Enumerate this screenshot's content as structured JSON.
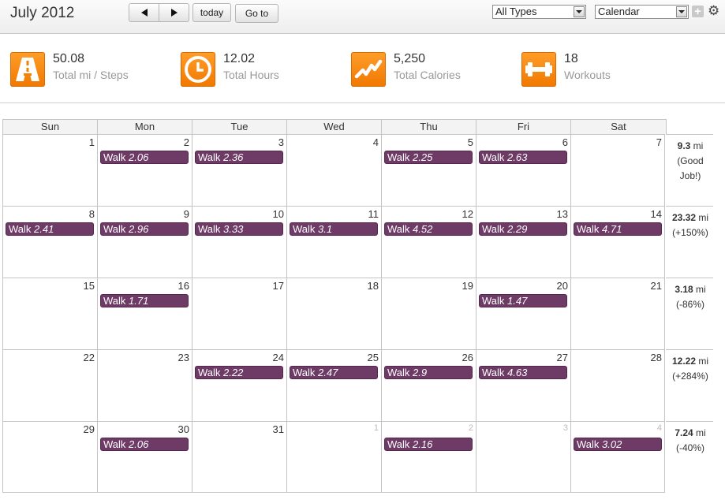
{
  "header": {
    "month_title": "July 2012",
    "today_label": "today",
    "goto_label": "Go to",
    "types_select": "All Types",
    "view_select": "Calendar"
  },
  "stats": [
    {
      "value": "50.08",
      "label": "Total mi / Steps",
      "icon": "road-icon"
    },
    {
      "value": "12.02",
      "label": "Total Hours",
      "icon": "clock-icon"
    },
    {
      "value": "5,250",
      "label": "Total Calories",
      "icon": "activity-chart-icon"
    },
    {
      "value": "18",
      "label": "Workouts",
      "icon": "dumbbell-icon"
    }
  ],
  "weekdays": [
    "Sun",
    "Mon",
    "Tue",
    "Wed",
    "Thu",
    "Fri",
    "Sat"
  ],
  "weeks": [
    {
      "days": [
        {
          "num": "1",
          "event": null,
          "other": false
        },
        {
          "num": "2",
          "event": {
            "type": "Walk",
            "value": "2.06"
          },
          "other": false
        },
        {
          "num": "3",
          "event": {
            "type": "Walk",
            "value": "2.36"
          },
          "other": false
        },
        {
          "num": "4",
          "event": null,
          "other": false
        },
        {
          "num": "5",
          "event": {
            "type": "Walk",
            "value": "2.25"
          },
          "other": false
        },
        {
          "num": "6",
          "event": {
            "type": "Walk",
            "value": "2.63"
          },
          "other": false
        },
        {
          "num": "7",
          "event": null,
          "other": false
        }
      ],
      "summary": {
        "total": "9.3",
        "unit": "mi",
        "note": "(Good Job!)"
      }
    },
    {
      "days": [
        {
          "num": "8",
          "event": {
            "type": "Walk",
            "value": "2.41"
          },
          "other": false
        },
        {
          "num": "9",
          "event": {
            "type": "Walk",
            "value": "2.96"
          },
          "other": false
        },
        {
          "num": "10",
          "event": {
            "type": "Walk",
            "value": "3.33"
          },
          "other": false
        },
        {
          "num": "11",
          "event": {
            "type": "Walk",
            "value": "3.1"
          },
          "other": false
        },
        {
          "num": "12",
          "event": {
            "type": "Walk",
            "value": "4.52"
          },
          "other": false
        },
        {
          "num": "13",
          "event": {
            "type": "Walk",
            "value": "2.29"
          },
          "other": false
        },
        {
          "num": "14",
          "event": {
            "type": "Walk",
            "value": "4.71"
          },
          "other": false
        }
      ],
      "summary": {
        "total": "23.32",
        "unit": "mi",
        "note": "(+150%)"
      }
    },
    {
      "days": [
        {
          "num": "15",
          "event": null,
          "other": false
        },
        {
          "num": "16",
          "event": {
            "type": "Walk",
            "value": "1.71"
          },
          "other": false
        },
        {
          "num": "17",
          "event": null,
          "other": false
        },
        {
          "num": "18",
          "event": null,
          "other": false
        },
        {
          "num": "19",
          "event": null,
          "other": false
        },
        {
          "num": "20",
          "event": {
            "type": "Walk",
            "value": "1.47"
          },
          "other": false
        },
        {
          "num": "21",
          "event": null,
          "other": false
        }
      ],
      "summary": {
        "total": "3.18",
        "unit": "mi",
        "note": "(-86%)"
      }
    },
    {
      "days": [
        {
          "num": "22",
          "event": null,
          "other": false
        },
        {
          "num": "23",
          "event": null,
          "other": false
        },
        {
          "num": "24",
          "event": {
            "type": "Walk",
            "value": "2.22"
          },
          "other": false
        },
        {
          "num": "25",
          "event": {
            "type": "Walk",
            "value": "2.47"
          },
          "other": false
        },
        {
          "num": "26",
          "event": {
            "type": "Walk",
            "value": "2.9"
          },
          "other": false
        },
        {
          "num": "27",
          "event": {
            "type": "Walk",
            "value": "4.63"
          },
          "other": false
        },
        {
          "num": "28",
          "event": null,
          "other": false
        }
      ],
      "summary": {
        "total": "12.22",
        "unit": "mi",
        "note": "(+284%)"
      }
    },
    {
      "days": [
        {
          "num": "29",
          "event": null,
          "other": false
        },
        {
          "num": "30",
          "event": {
            "type": "Walk",
            "value": "2.06"
          },
          "other": false
        },
        {
          "num": "31",
          "event": null,
          "other": false
        },
        {
          "num": "1",
          "event": null,
          "other": true
        },
        {
          "num": "2",
          "event": {
            "type": "Walk",
            "value": "2.16"
          },
          "other": true
        },
        {
          "num": "3",
          "event": null,
          "other": true
        },
        {
          "num": "4",
          "event": {
            "type": "Walk",
            "value": "3.02"
          },
          "other": true
        }
      ],
      "summary": {
        "total": "7.24",
        "unit": "mi",
        "note": "(-40%)"
      }
    }
  ],
  "colors": {
    "accent_orange": "#f58a0f",
    "event_purple": "#6e3a66"
  }
}
